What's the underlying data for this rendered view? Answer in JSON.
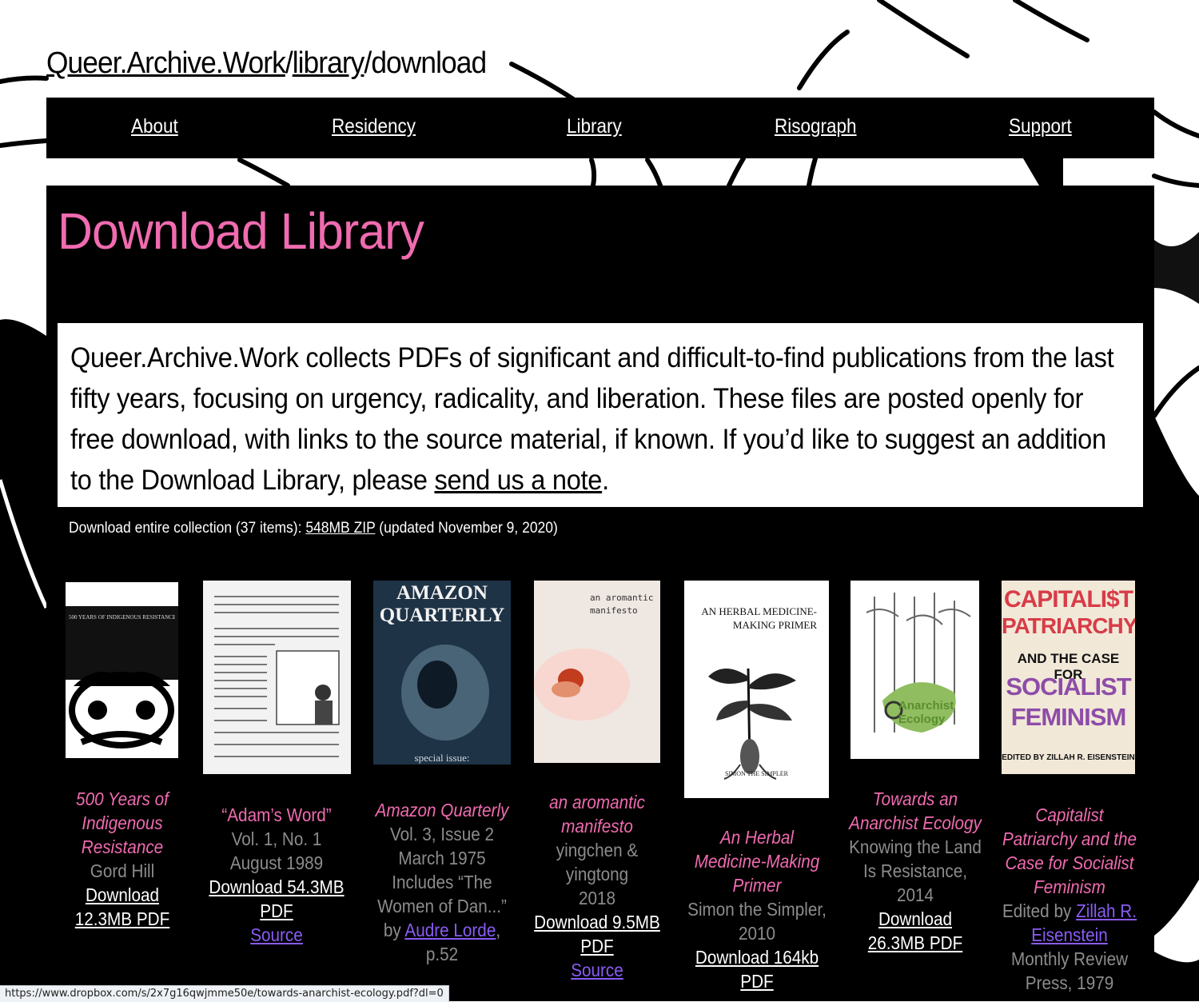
{
  "breadcrumb": {
    "site": "Queer.Archive.Work",
    "sep1": "/",
    "section": "library",
    "sep2": "/",
    "page": "download"
  },
  "nav": {
    "items": [
      "About",
      "Residency",
      "Library",
      "Risograph",
      "Support"
    ]
  },
  "main": {
    "title": "Download Library",
    "intro": {
      "text": "Queer.Archive.Work collects PDFs of significant and difficult-to-find publications from the last fifty years, focusing on urgency, radicality, and liberation. These files are posted openly for free download, with links to the source material, if known. If you’d like to suggest an addition to the Download Library, please ",
      "link": "send us a note",
      "end": "."
    },
    "collection": {
      "prefix": "Download entire collection (37 items): ",
      "link": "548MB ZIP",
      "suffix": " (updated November 9, 2020)"
    },
    "books": [
      {
        "title": "500 Years of Indigenous Resistance",
        "meta": [
          "Gord Hill"
        ],
        "download": "Download 12.3MB PDF",
        "cover_text": "500 YEARS OF INDIGENOUS RESISTANCE"
      },
      {
        "title": "“Adam’s Word”",
        "meta": [
          "Vol. 1, No. 1",
          "August 1989"
        ],
        "download": "Download 54.3MB PDF",
        "source": "Source"
      },
      {
        "title": "Amazon Quarterly",
        "meta": [
          "Vol. 3, Issue 2",
          "March 1975",
          "Includes “The Women of Dan...”"
        ],
        "by_prefix": "by ",
        "by_link": "Audre Lorde",
        "by_suffix": ",",
        "page": "p.52",
        "cover_title": "AMAZON QUARTERLY",
        "cover_bottom": "special issue:"
      },
      {
        "title": "an aromantic manifesto",
        "meta": [
          "yingchen & yingtong",
          "2018"
        ],
        "download": "Download 9.5MB PDF",
        "source": "Source",
        "cover_title": "an aromantic manifesto"
      },
      {
        "title": "An Herbal Medicine-Making Primer",
        "meta": [
          "Simon the Simpler, 2010"
        ],
        "download": "Download 164kb PDF",
        "cover_title": "AN HERBAL MEDICINE-MAKING PRIMER",
        "cover_bottom": "SIMON THE SIMPLER"
      },
      {
        "title": "Towards an Anarchist Ecology",
        "meta": [
          "Knowing the Land Is Resistance,",
          "2014"
        ],
        "download": "Download 26.3MB PDF",
        "cover_title": "Anarchist Ecology"
      },
      {
        "title": "Capitalist Patriarchy and the Case for Socialist Feminism",
        "edited_prefix": "Edited by ",
        "edited_link": "Zillah R. Eisenstein",
        "meta": [
          "Monthly Review Press, 1979"
        ],
        "cover_lines": [
          "CAPITALI$T",
          "PATRIARCHY",
          "AND THE CASE FOR",
          "SOCIALIST",
          "FEMINISM",
          "EDITED BY ZILLAH R. EISENSTEIN"
        ]
      }
    ]
  },
  "statusbar": {
    "url": "https://www.dropbox.com/s/2x7g16qwjmme50e/towards-anarchist-ecology.pdf?dl=0"
  },
  "colors": {
    "accent_pink": "#f06bb0",
    "link_purple": "#8a5cf5",
    "panel_black": "#000000"
  }
}
